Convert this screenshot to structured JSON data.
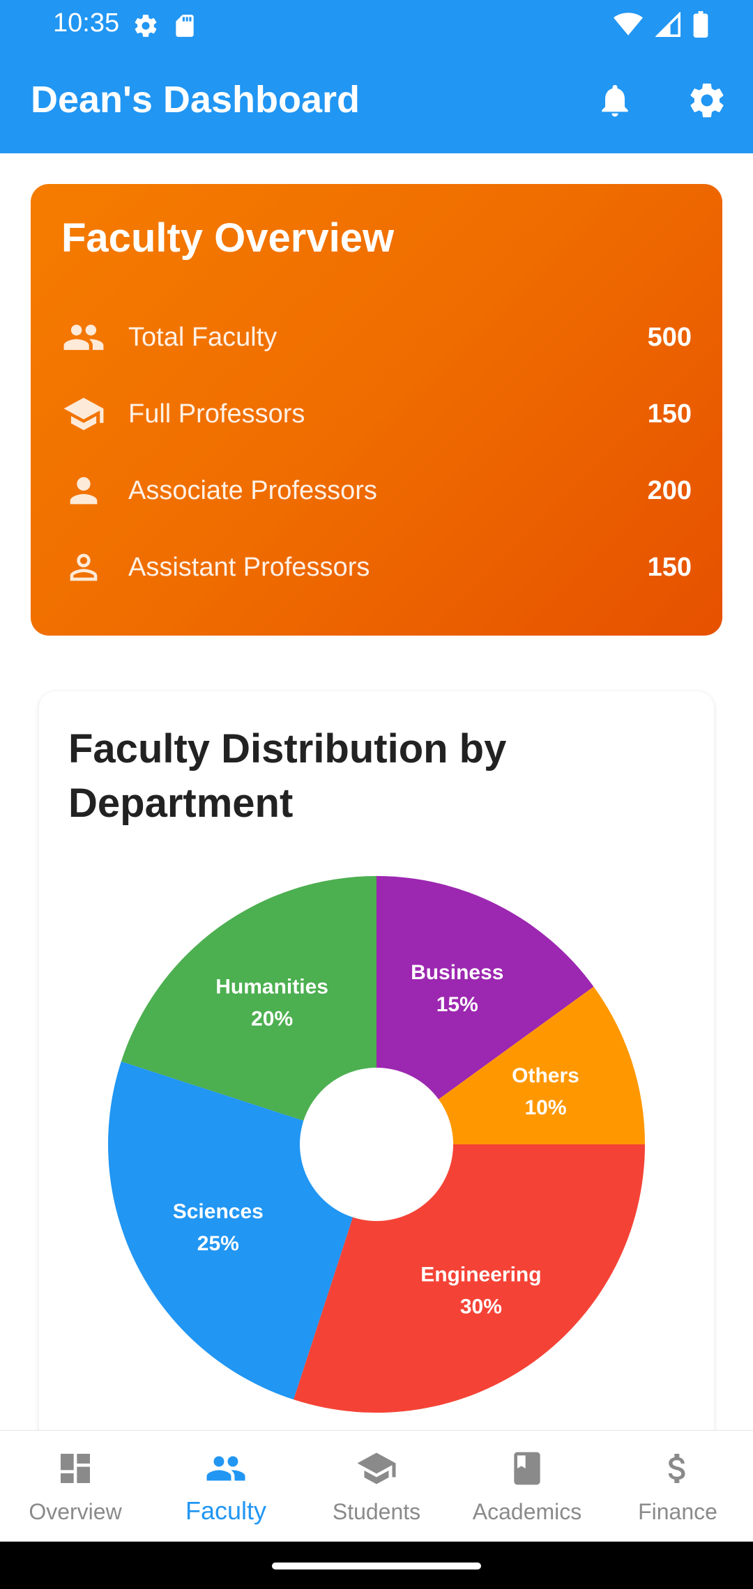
{
  "status_bar": {
    "time": "10:35"
  },
  "app_bar": {
    "title": "Dean's Dashboard"
  },
  "overview": {
    "title": "Faculty Overview",
    "rows": [
      {
        "icon": "people-icon",
        "label": "Total Faculty",
        "value": "500"
      },
      {
        "icon": "graduation-cap-icon",
        "label": "Full Professors",
        "value": "150"
      },
      {
        "icon": "person-icon",
        "label": "Associate Professors",
        "value": "200"
      },
      {
        "icon": "person-outline-icon",
        "label": "Assistant Professors",
        "value": "150"
      }
    ],
    "colors": {
      "start": "#F57C00",
      "end": "#E65100"
    }
  },
  "distribution": {
    "title": "Faculty Distribution by Department"
  },
  "chart_data": {
    "type": "pie",
    "title": "Faculty Distribution by Department",
    "donut": true,
    "categories": [
      "Business",
      "Others",
      "Engineering",
      "Sciences",
      "Humanities"
    ],
    "values": [
      15,
      10,
      30,
      25,
      20
    ],
    "labels": [
      "15%",
      "10%",
      "30%",
      "25%",
      "20%"
    ],
    "colors": [
      "#9C27B0",
      "#FF9800",
      "#F44336",
      "#2196F3",
      "#4CAF50"
    ]
  },
  "bottom_nav": {
    "items": [
      {
        "label": "Overview",
        "icon": "dashboard-icon",
        "active": false
      },
      {
        "label": "Faculty",
        "icon": "people-icon",
        "active": true
      },
      {
        "label": "Students",
        "icon": "graduation-cap-icon",
        "active": false
      },
      {
        "label": "Academics",
        "icon": "book-icon",
        "active": false
      },
      {
        "label": "Finance",
        "icon": "dollar-icon",
        "active": false
      }
    ]
  },
  "theme": {
    "primary": "#2196F3",
    "inactive": "#8A8A8A"
  }
}
